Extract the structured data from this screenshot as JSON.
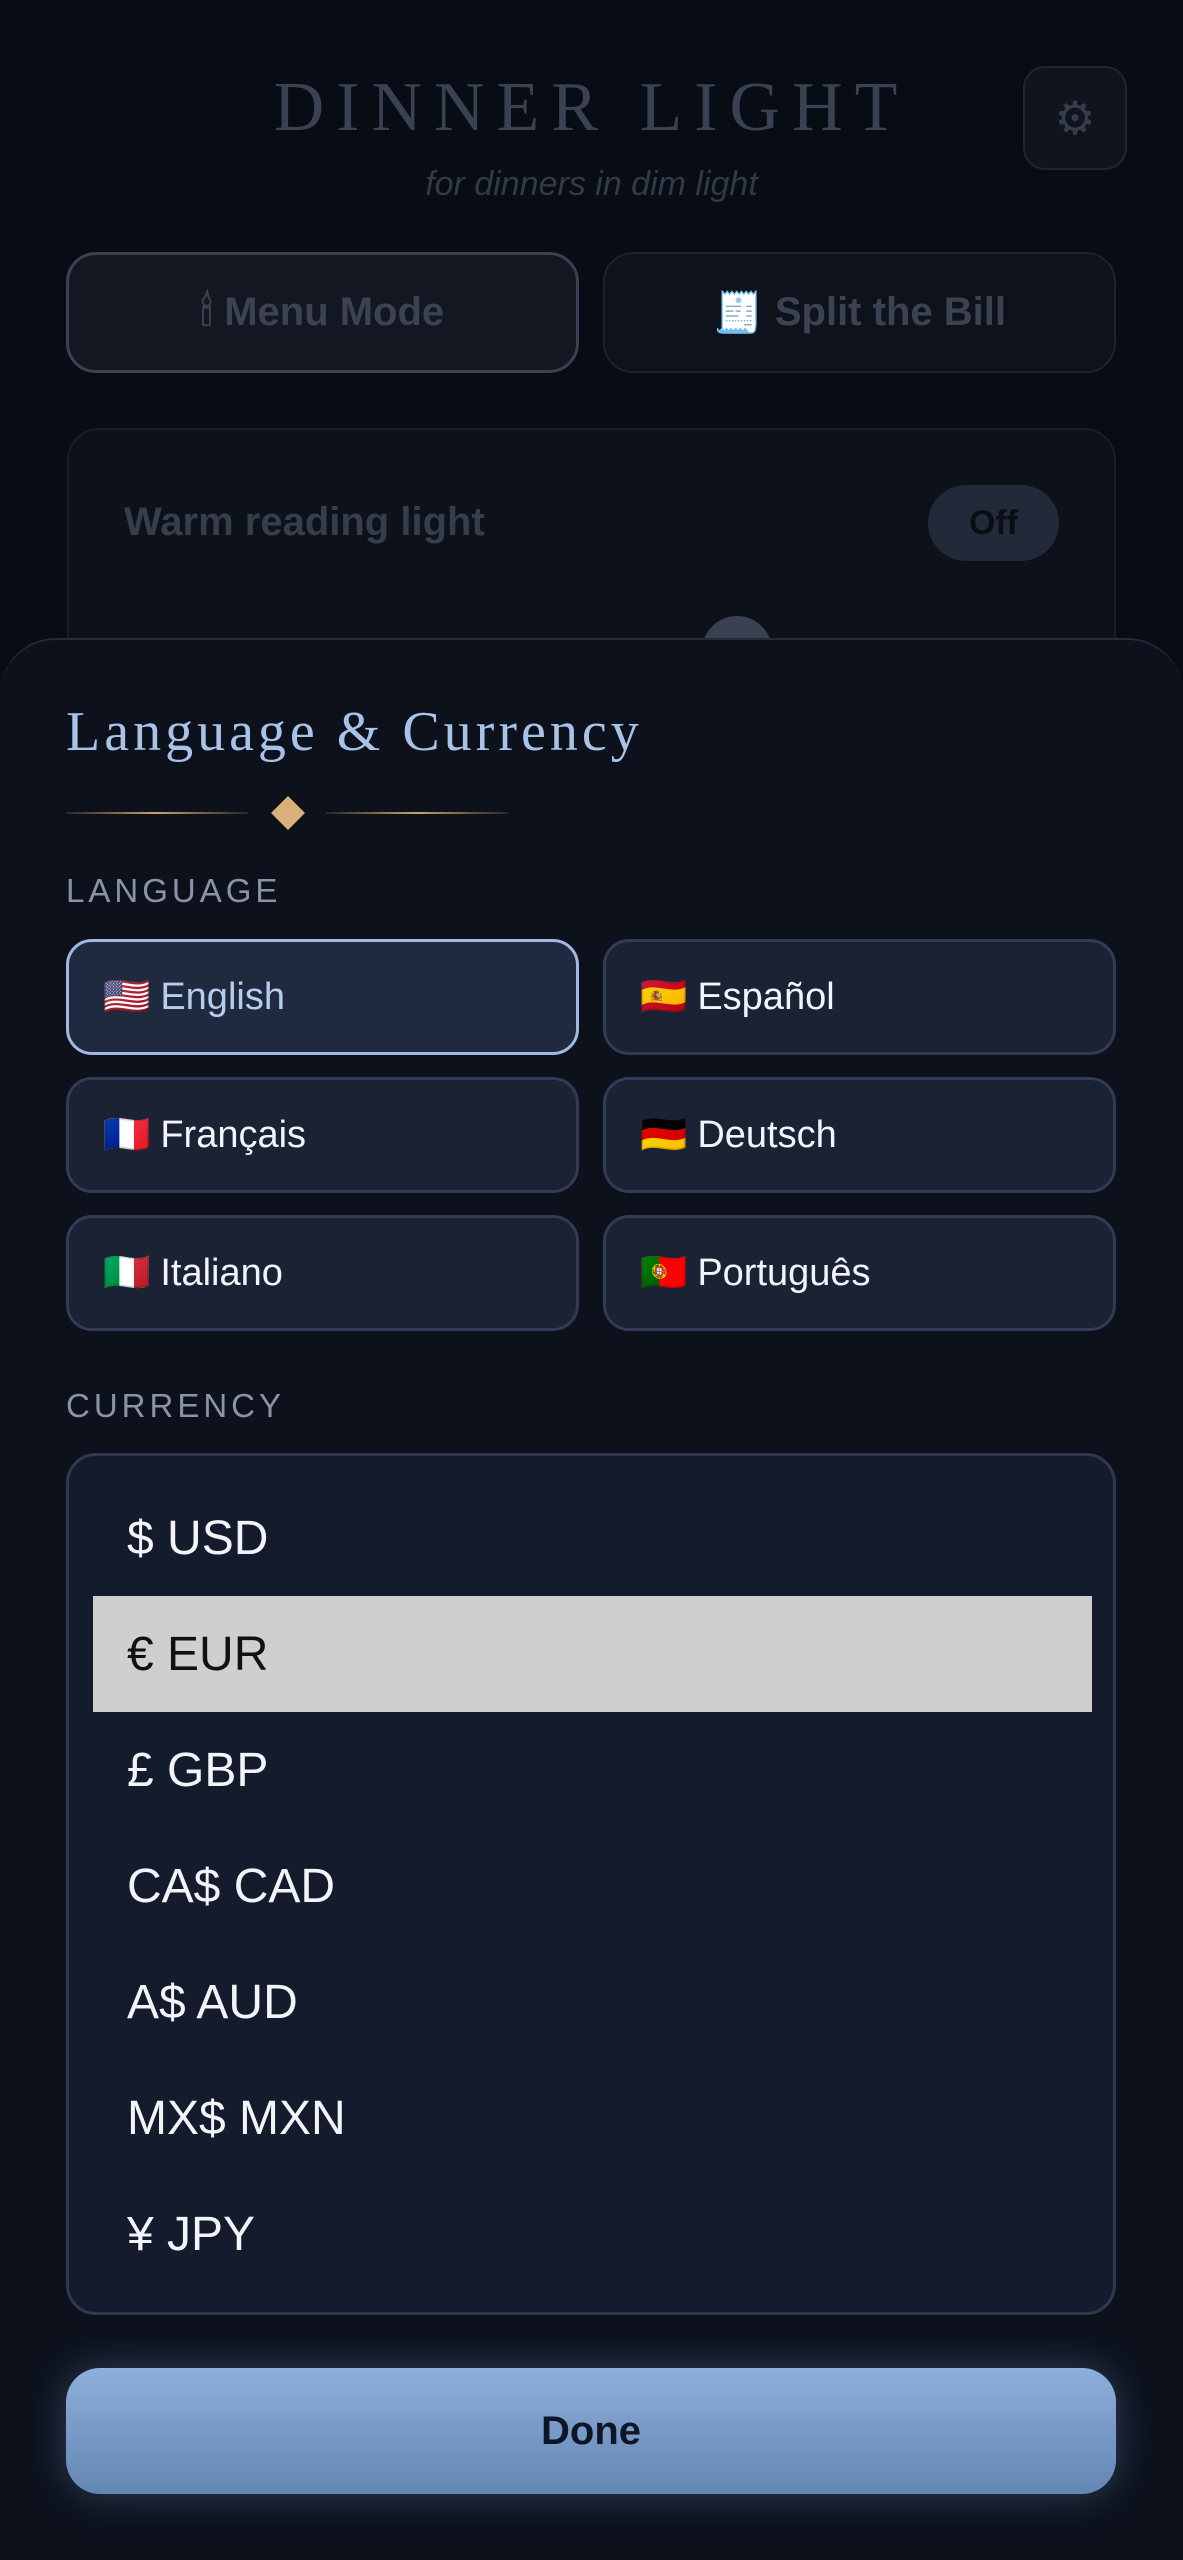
{
  "app": {
    "title": "DINNER LIGHT",
    "subtitle": "for dinners in dim light",
    "settings_icon": "⚙",
    "modes": [
      {
        "icon": "🕯",
        "label": "Menu Mode"
      },
      {
        "icon": "🧾",
        "label": "Split the Bill"
      }
    ],
    "warm_light": {
      "label": "Warm reading light",
      "toggle_label": "Off"
    }
  },
  "sheet": {
    "title": "Language & Currency",
    "language_label": "LANGUAGE",
    "languages": [
      {
        "flag": "🇺🇸",
        "label": "English",
        "selected": true
      },
      {
        "flag": "🇪🇸",
        "label": "Español",
        "selected": false
      },
      {
        "flag": "🇫🇷",
        "label": "Français",
        "selected": false
      },
      {
        "flag": "🇩🇪",
        "label": "Deutsch",
        "selected": false
      },
      {
        "flag": "🇮🇹",
        "label": "Italiano",
        "selected": false
      },
      {
        "flag": "🇵🇹",
        "label": "Português",
        "selected": false
      }
    ],
    "currency_label": "CURRENCY",
    "currencies": [
      "$ USD",
      "€ EUR",
      "£ GBP",
      "CA$ CAD",
      "A$ AUD",
      "MX$ MXN",
      "¥ JPY"
    ],
    "highlighted_currency": "€ EUR",
    "done_label": "Done"
  },
  "colors": {
    "accent": "#9fb9e0",
    "divider_gold": "#c9a268",
    "done_button": "#7a9ac7"
  }
}
